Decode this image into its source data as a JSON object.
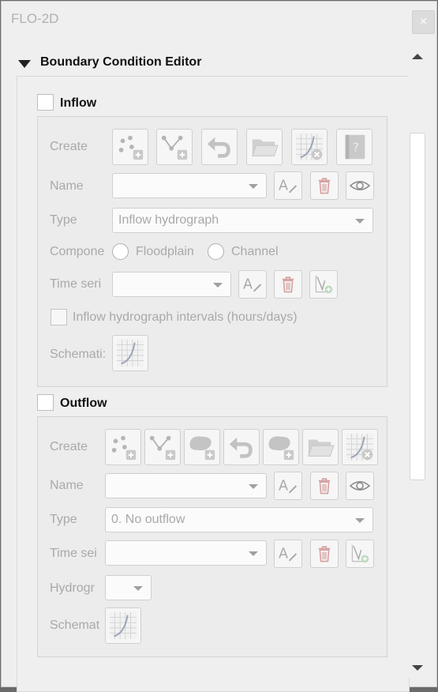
{
  "window": {
    "title": "FLO-2D",
    "close_label": "×"
  },
  "section": {
    "title": "Boundary Condition Editor"
  },
  "inflow": {
    "title": "Inflow",
    "create_label": "Create",
    "name_label": "Name",
    "name_value": "",
    "type_label": "Type",
    "type_value": "Inflow hydrograph",
    "component_label": "Compone",
    "floodplain_label": "Floodplain",
    "channel_label": "Channel",
    "timeseries_label": "Time seri",
    "timeseries_value": "",
    "intervals_label": "Inflow hydrograph intervals (hours/days)",
    "schematize_label": "Schemati:"
  },
  "outflow": {
    "title": "Outflow",
    "create_label": "Create",
    "name_label": "Name",
    "name_value": "",
    "type_label": "Type",
    "type_value": "0. No outflow",
    "timeseries_label": "Time sei",
    "timeseries_value": "",
    "hydrograph_label": "Hydrogr",
    "hydrograph_value": "",
    "schematize_label": "Schemat"
  },
  "icons": {
    "create_points": "add-points-icon",
    "create_line": "add-line-icon",
    "create_polygon": "add-polygon-icon",
    "revert": "revert-icon",
    "open": "folder-icon",
    "schematize": "schematize-icon",
    "help": "help-book-icon",
    "rename": "rename-icon",
    "delete": "trash-icon",
    "show": "eye-icon",
    "add_table": "add-table-icon"
  },
  "colors": {
    "background": "#efefef",
    "disabled_text": "#a9a9a9",
    "heading_text": "#111111"
  }
}
